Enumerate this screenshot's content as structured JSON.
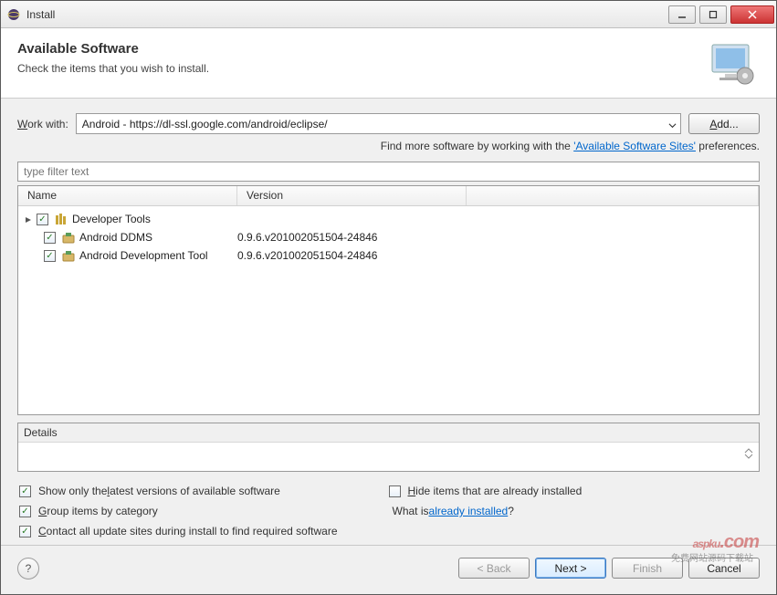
{
  "titlebar": {
    "title": "Install"
  },
  "banner": {
    "title": "Available Software",
    "subtitle": "Check the items that you wish to install."
  },
  "workwith": {
    "label_pre": "W",
    "label_post": "ork with:",
    "value": "Android - https://dl-ssl.google.com/android/eclipse/",
    "add_label_pre": "A",
    "add_label_post": "dd..."
  },
  "hint": {
    "pre": "Find more software by working with the ",
    "link": "'Available Software Sites'",
    "post": " preferences."
  },
  "filter_placeholder": "type filter text",
  "columns": {
    "name": "Name",
    "version": "Version"
  },
  "tree": [
    {
      "level": 0,
      "checked": true,
      "name": "Developer Tools",
      "version": "",
      "expanded": true,
      "icon": "category"
    },
    {
      "level": 1,
      "checked": true,
      "name": "Android DDMS",
      "version": "0.9.6.v201002051504-24846",
      "icon": "feature"
    },
    {
      "level": 1,
      "checked": true,
      "name": "Android Development Tool",
      "version": "0.9.6.v201002051504-24846",
      "icon": "feature"
    }
  ],
  "details_label": "Details",
  "options": {
    "left": [
      {
        "checked": true,
        "pre": "Show only the ",
        "u": "l",
        "post": "atest versions of available software"
      },
      {
        "checked": true,
        "pre": "",
        "u": "G",
        "post": "roup items by category"
      },
      {
        "checked": true,
        "pre": "",
        "u": "C",
        "post": "ontact all update sites during install to find required software"
      }
    ],
    "right_check": {
      "checked": false,
      "pre": "",
      "u": "H",
      "post": "ide items that are already installed"
    },
    "whatis_pre": "What is ",
    "whatis_link": "already installed",
    "whatis_post": "?"
  },
  "footer": {
    "back": "< Back",
    "next": "Next >",
    "finish": "Finish",
    "cancel": "Cancel"
  },
  "watermark": {
    "main": "aspku",
    "sub": "免费网站源码下载站",
    "dom": ".com"
  }
}
